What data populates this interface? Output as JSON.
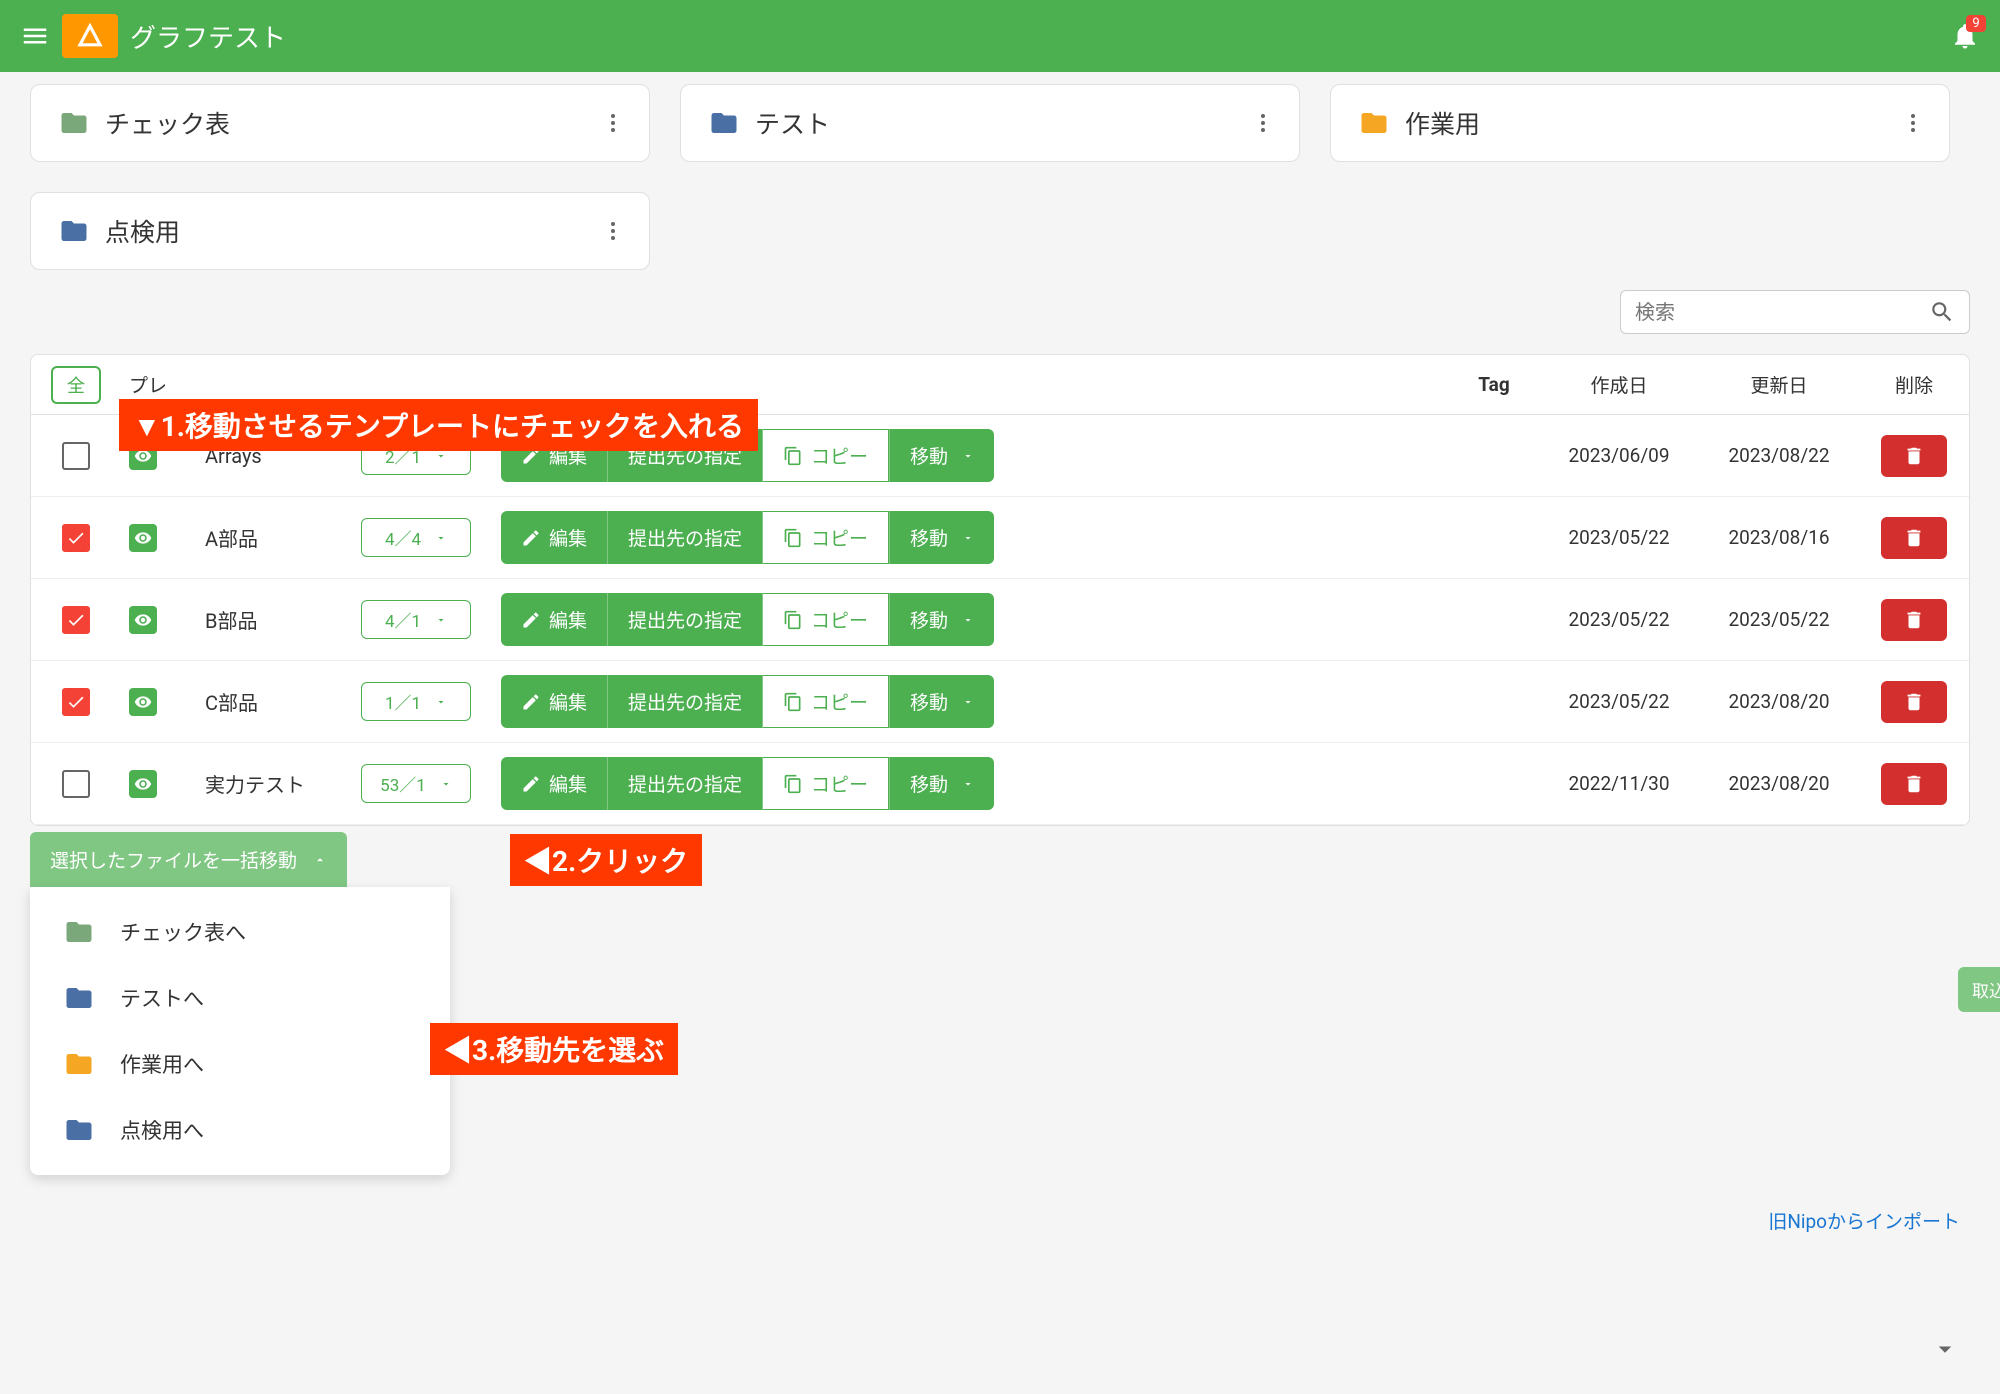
{
  "header": {
    "title": "グラフテスト",
    "badge_count": "9"
  },
  "folders": [
    {
      "name": "チェック表",
      "color": "#7BA87B"
    },
    {
      "name": "テスト",
      "color": "#4A6FA5"
    },
    {
      "name": "作業用",
      "color": "#F5A623"
    },
    {
      "name": "点検用",
      "color": "#4A6FA5"
    }
  ],
  "search": {
    "placeholder": "検索"
  },
  "table": {
    "select_all": "全",
    "headers": {
      "pre": "プレ",
      "tag": "Tag",
      "created": "作成日",
      "updated": "更新日",
      "delete": "削除"
    }
  },
  "rows": [
    {
      "checked": false,
      "name": "Arrays",
      "ratio": "2／1",
      "created": "2023/06/09",
      "updated": "2023/08/22"
    },
    {
      "checked": true,
      "name": "A部品",
      "ratio": "4／4",
      "created": "2023/05/22",
      "updated": "2023/08/16"
    },
    {
      "checked": true,
      "name": "B部品",
      "ratio": "4／1",
      "created": "2023/05/22",
      "updated": "2023/05/22"
    },
    {
      "checked": true,
      "name": "C部品",
      "ratio": "1／1",
      "created": "2023/05/22",
      "updated": "2023/08/20"
    },
    {
      "checked": false,
      "name": "実力テスト",
      "ratio": "53／1",
      "created": "2022/11/30",
      "updated": "2023/08/20"
    }
  ],
  "actions": {
    "edit": "編集",
    "submit": "提出先の指定",
    "copy": "コピー",
    "move": "移動"
  },
  "bulk": {
    "button": "選択したファイルを一括移動",
    "items": [
      {
        "label": "チェック表へ",
        "color": "#7BA87B"
      },
      {
        "label": "テストへ",
        "color": "#4A6FA5"
      },
      {
        "label": "作業用へ",
        "color": "#F5A623"
      },
      {
        "label": "点検用へ",
        "color": "#4A6FA5"
      }
    ]
  },
  "csv_import": "取込",
  "annotations": {
    "a1": "▼1.移動させるテンプレートにチェックを入れる",
    "a2": "◀2.クリック",
    "a3": "◀3.移動先を選ぶ"
  },
  "footer": {
    "import_link": "旧Nipoからインポート"
  }
}
